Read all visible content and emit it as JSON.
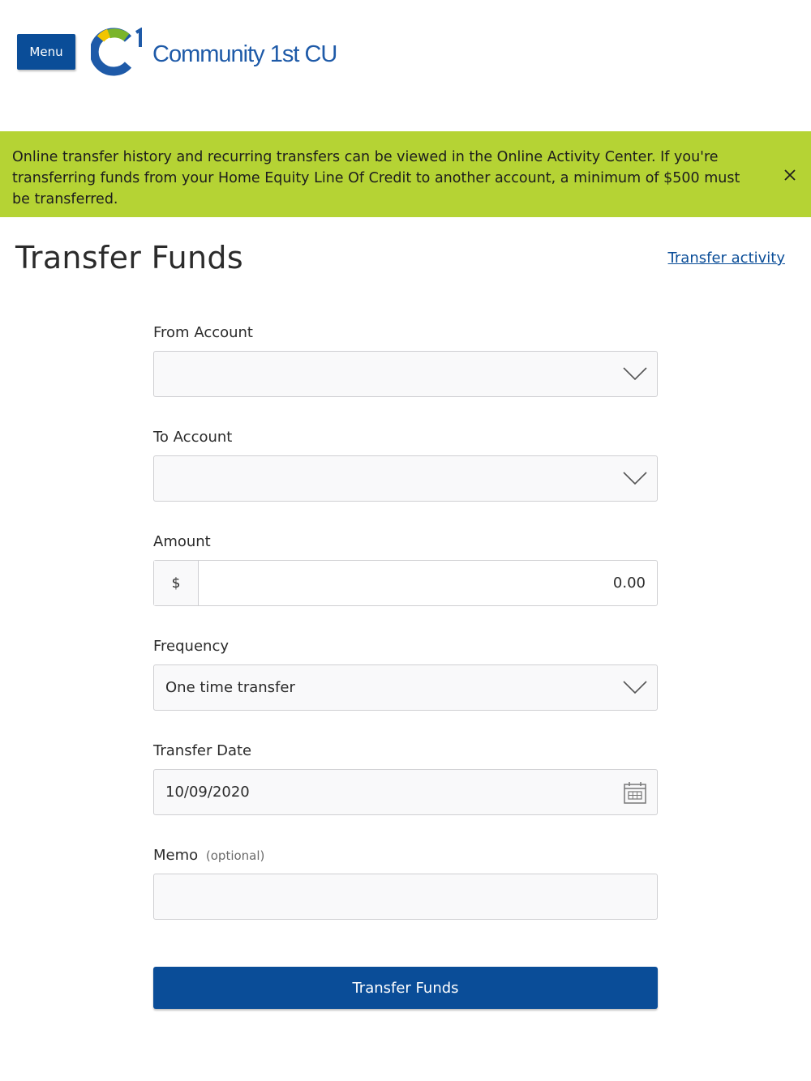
{
  "header": {
    "menu_label": "Menu",
    "logo_text": "Community 1st CU"
  },
  "banner": {
    "message": "Online transfer history and recurring transfers can be viewed in the Online Activity Center. If you're transferring funds from your Home Equity Line Of Credit to another account, a minimum of $500 must be transferred.",
    "close_icon": "close-icon",
    "background_color": "#b5d334"
  },
  "page": {
    "title": "Transfer Funds",
    "activity_link": "Transfer activity"
  },
  "form": {
    "from_account": {
      "label": "From Account",
      "value": ""
    },
    "to_account": {
      "label": "To Account",
      "value": ""
    },
    "amount": {
      "label": "Amount",
      "prefix": "$",
      "value": "0.00"
    },
    "frequency": {
      "label": "Frequency",
      "value": "One time transfer"
    },
    "transfer_date": {
      "label": "Transfer Date",
      "value": "10/09/2020"
    },
    "memo": {
      "label": "Memo",
      "optional_note": "(optional)",
      "value": ""
    },
    "submit_label": "Transfer Funds"
  },
  "colors": {
    "brand_blue": "#0a4d98",
    "logo_green": "#7ab52a",
    "banner_green": "#b5d334"
  }
}
